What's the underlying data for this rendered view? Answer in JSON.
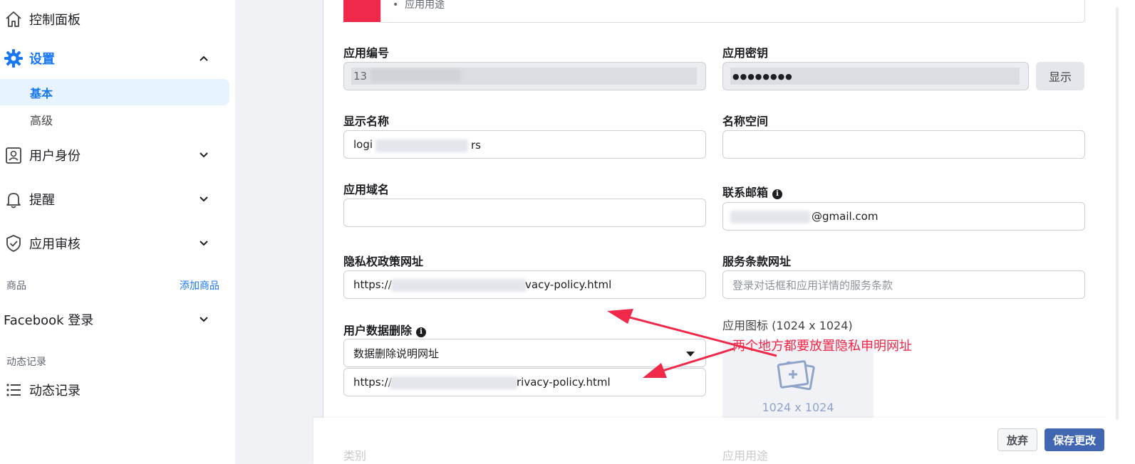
{
  "sidebar": {
    "items": [
      {
        "label": "控制面板",
        "icon": "home-icon"
      },
      {
        "label": "设置",
        "icon": "gear-icon",
        "expanded": true
      },
      {
        "label": "用户身份",
        "icon": "id-card-icon"
      },
      {
        "label": "提醒",
        "icon": "bell-icon"
      },
      {
        "label": "应用审核",
        "icon": "shield-check-icon"
      },
      {
        "label": "Facebook 登录"
      },
      {
        "label": "动态记录",
        "icon": "list-icon"
      }
    ],
    "settings_sub": [
      {
        "label": "基本",
        "selected": true
      },
      {
        "label": "高级"
      }
    ],
    "products_section": "商品",
    "add_product": "添加商品",
    "activity_section": "动态记录"
  },
  "main": {
    "top_bullet": "应用用途",
    "app_id": {
      "label": "应用编号",
      "value": "13"
    },
    "app_secret": {
      "label": "应用密钥",
      "value": "●●●●●●●●",
      "show_button": "显示"
    },
    "display_name": {
      "label": "显示名称",
      "value": "logi",
      "value_tail": "rs"
    },
    "namespace": {
      "label": "名称空间",
      "value": ""
    },
    "app_domain": {
      "label": "应用域名",
      "value": ""
    },
    "contact_email": {
      "label": "联系邮箱",
      "value": "@gmail.com"
    },
    "privacy_url": {
      "label": "隐私权政策网址",
      "prefix": "https://",
      "suffix": "vacy-policy.html"
    },
    "tos_url": {
      "label": "服务条款网址",
      "placeholder": "登录对话框和应用详情的服务条款"
    },
    "data_deletion": {
      "label": "用户数据删除",
      "select_value": "数据删除说明网址",
      "prefix": "https://",
      "suffix": "rivacy-policy.html"
    },
    "app_icon": {
      "label": "应用图标 (1024 x 1024)",
      "size_text": "1024 x 1024"
    },
    "category_label": "类别",
    "app_use_label": "应用用途"
  },
  "annotation": {
    "text": "两个地方都要放置隐私申明网址",
    "color": "#f02849"
  },
  "footer": {
    "discard": "放弃",
    "save": "保存更改"
  },
  "colors": {
    "brand_blue": "#1877f2",
    "save_button": "#4267b2",
    "annotation_red": "#f02849"
  }
}
